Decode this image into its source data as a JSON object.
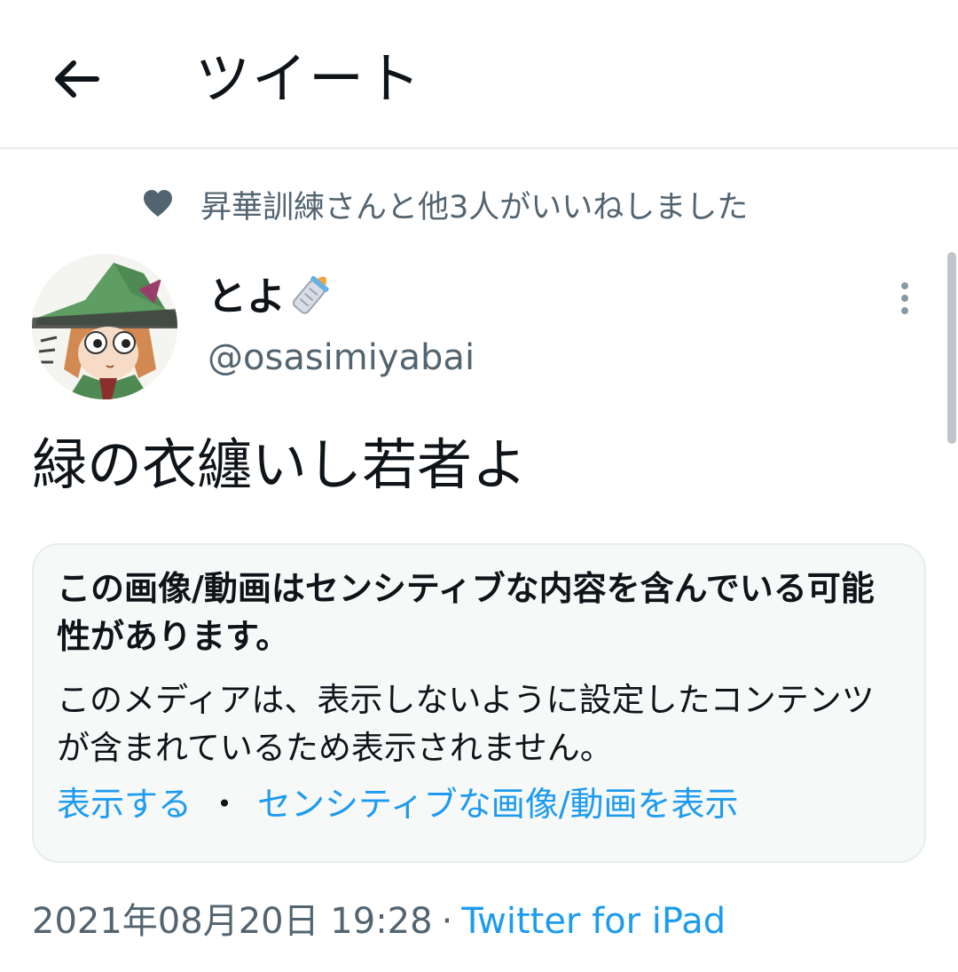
{
  "header": {
    "title": "ツイート",
    "back_icon": "arrow-left-icon"
  },
  "social_context": {
    "icon": "heart-icon",
    "text": "昇華訓練さんと他3人がいいねしました"
  },
  "author": {
    "display_name": "とよ",
    "emoji": "baby-bottle-icon",
    "handle": "@osasimiyabai"
  },
  "tweet": {
    "text": "緑の衣纏いし若者よ"
  },
  "sensitive_notice": {
    "title": "この画像/動画はセンシティブな内容を含んでいる可能性があります。",
    "body": "このメディアは、表示しないように設定したコンテンツが含まれているため表示されません。",
    "show_link": "表示する",
    "separator": "・",
    "settings_link": "センシティブな画像/動画を表示"
  },
  "meta": {
    "timestamp": "2021年08月20日 19:28",
    "dot": "·",
    "source": "Twitter for iPad"
  },
  "colors": {
    "link": "#1d9bf0",
    "secondary_text": "#536471",
    "primary_text": "#0f1419",
    "card_bg": "#f7f9f9"
  }
}
